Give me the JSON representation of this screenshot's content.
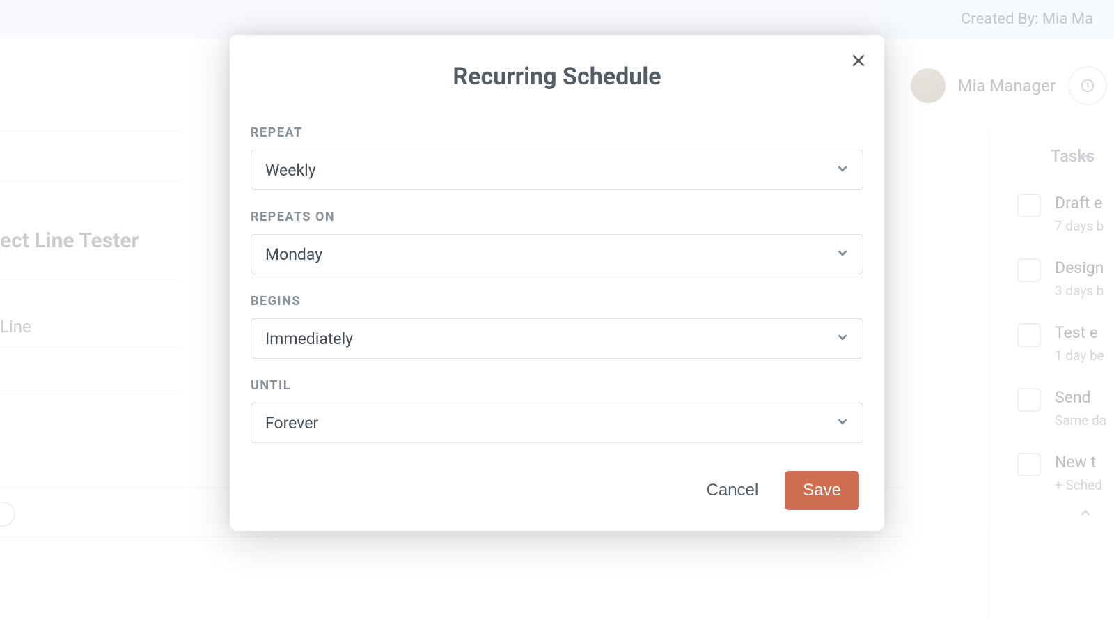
{
  "background": {
    "created_by_label": "Created By: Mia Ma",
    "user_name": "Mia Manager",
    "main_title": "ect Line Tester",
    "sub_line": "Line",
    "tasks_heading": "Tasks",
    "tasks": [
      {
        "title": "Draft e",
        "sub": "7 days b"
      },
      {
        "title": "Design",
        "sub": "3 days b"
      },
      {
        "title": "Test e",
        "sub": "1 day be"
      },
      {
        "title": "Send",
        "sub": "Same da"
      },
      {
        "title": "New t",
        "sub": "+ Sched"
      }
    ]
  },
  "modal": {
    "title": "Recurring Schedule",
    "fields": {
      "repeat": {
        "label": "REPEAT",
        "value": "Weekly"
      },
      "repeats_on": {
        "label": "REPEATS ON",
        "value": "Monday"
      },
      "begins": {
        "label": "BEGINS",
        "value": "Immediately"
      },
      "until": {
        "label": "UNTIL",
        "value": "Forever"
      }
    },
    "buttons": {
      "cancel": "Cancel",
      "save": "Save"
    }
  }
}
